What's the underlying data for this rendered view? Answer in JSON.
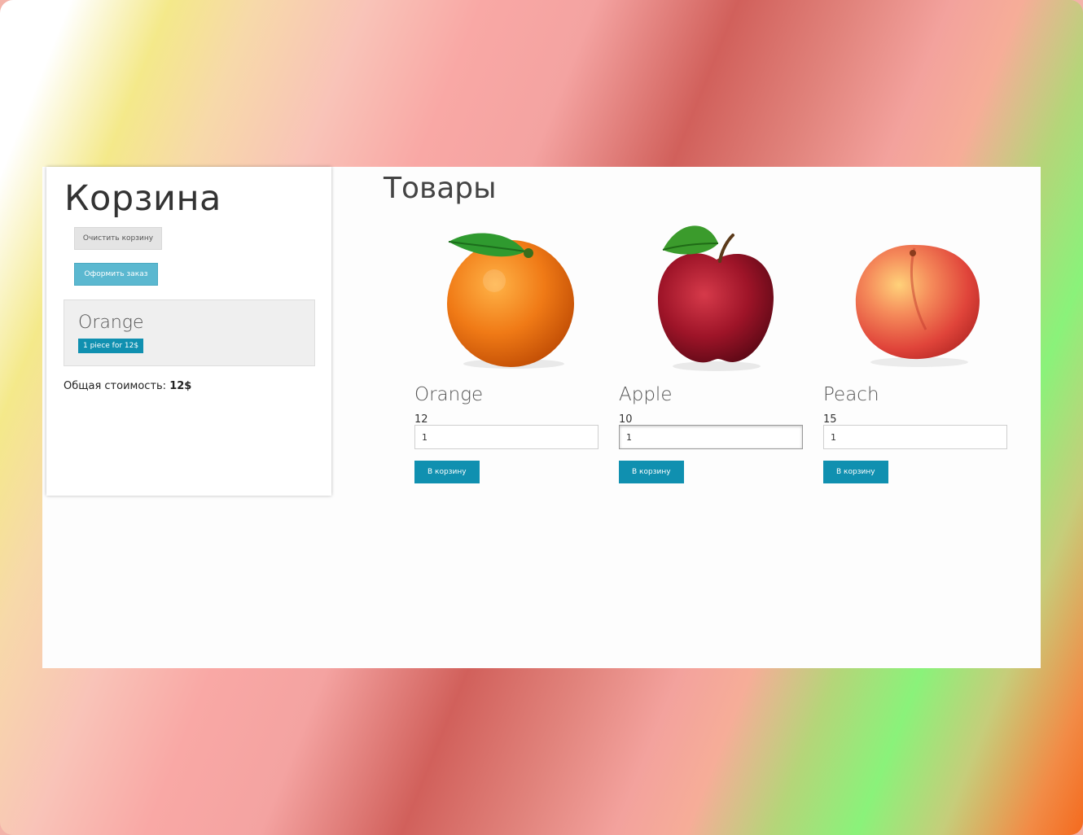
{
  "cart": {
    "title": "Корзина",
    "clear_label": "Очистить корзину",
    "order_label": "Оформить заказ",
    "items": [
      {
        "name": "Orange",
        "badge": "1 piece for 12$"
      }
    ],
    "total_label": "Общая стоимость:",
    "total_value": "12$"
  },
  "products": {
    "title": "Товары",
    "items": [
      {
        "name": "Orange",
        "price": "12",
        "quantity": "1",
        "add_label": "В корзину",
        "icon": "orange-icon"
      },
      {
        "name": "Apple",
        "price": "10",
        "quantity": "1",
        "add_label": "В корзину",
        "icon": "apple-icon"
      },
      {
        "name": "Peach",
        "price": "15",
        "quantity": "1",
        "add_label": "В корзину",
        "icon": "peach-icon"
      }
    ]
  },
  "colors": {
    "primary": "#1090b0",
    "order_button": "#5bb8d0",
    "clear_button": "#e4e4e4"
  }
}
